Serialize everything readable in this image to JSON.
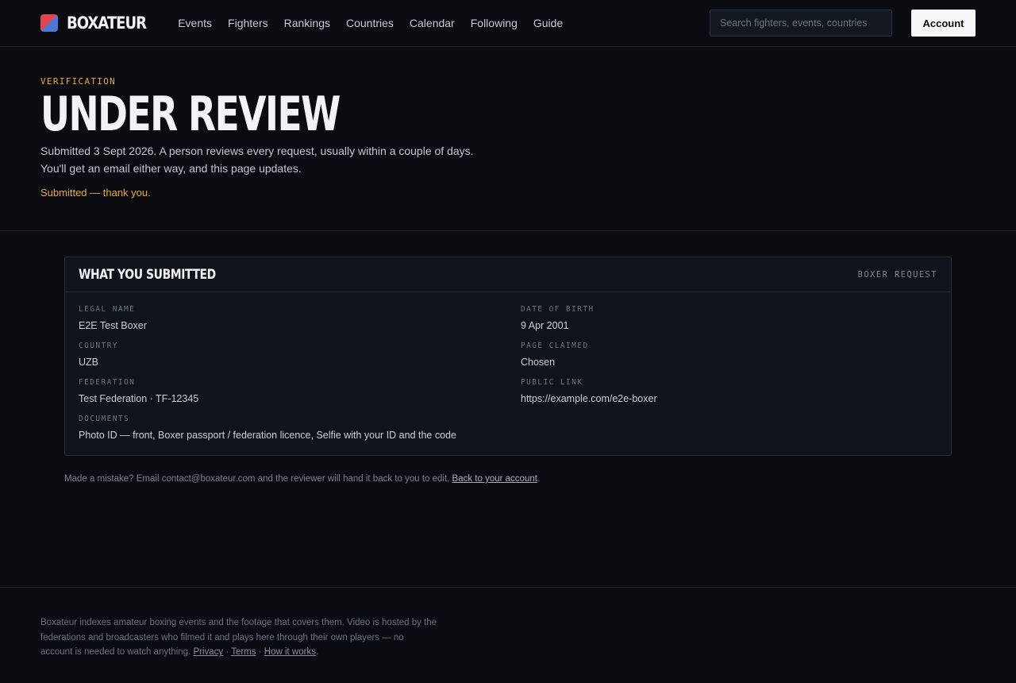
{
  "header": {
    "brand": "BOXATEUR",
    "nav": [
      "Events",
      "Fighters",
      "Rankings",
      "Countries",
      "Calendar",
      "Following",
      "Guide"
    ],
    "search_placeholder": "Search fighters, events, countries",
    "account_label": "Account"
  },
  "hero": {
    "eyebrow": "VERIFICATION",
    "title": "UNDER REVIEW",
    "lede_1": "Submitted 3 Sept 2026. A person reviews every request, usually within a couple of days.",
    "lede_2": "You'll get an email either way, and this page updates.",
    "confirmation": "Submitted — thank you."
  },
  "card": {
    "title": "WHAT YOU SUBMITTED",
    "tag": "BOXER REQUEST",
    "fields": [
      {
        "label": "LEGAL NAME",
        "value": "E2E Test Boxer"
      },
      {
        "label": "DATE OF BIRTH",
        "value": "9 Apr 2001"
      },
      {
        "label": "COUNTRY",
        "value": "UZB"
      },
      {
        "label": "PAGE CLAIMED",
        "value": "Chosen"
      },
      {
        "label": "FEDERATION",
        "value": "Test Federation · TF-12345"
      },
      {
        "label": "PUBLIC LINK",
        "value": "https://example.com/e2e-boxer"
      },
      {
        "label": "DOCUMENTS",
        "value": "Photo ID — front, Boxer passport / federation licence, Selfie with your ID and the code"
      }
    ]
  },
  "note": {
    "text": "Made a mistake? Email contact@boxateur.com and the reviewer will hand it back to you to edit.",
    "link": "Back to your account",
    "end": "."
  },
  "footer": {
    "text": "Boxateur indexes amateur boxing events and the footage that covers them. Video is hosted by the federations and broadcasters who filmed it and plays here through their own players — no account is needed to watch anything.",
    "links": [
      "Privacy",
      "Terms",
      "How it works"
    ],
    "sep": "·",
    "end": "."
  }
}
